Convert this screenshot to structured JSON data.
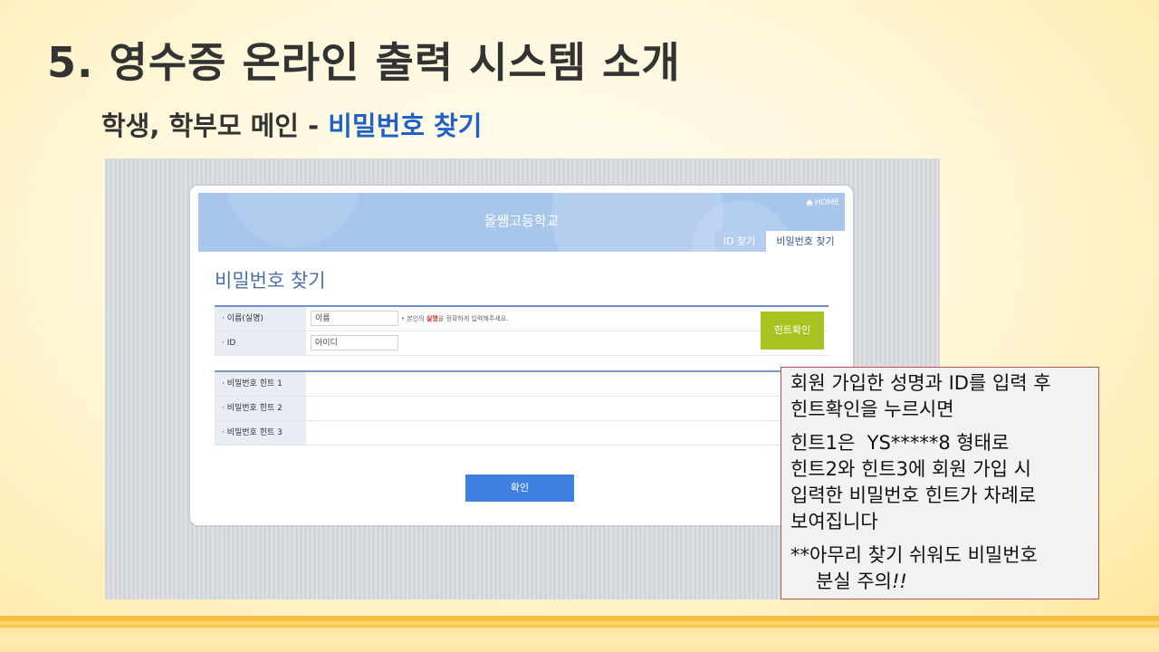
{
  "slide": {
    "title": "5. 영수증 온라인 출력 시스템 소개",
    "subtitle": "학생, 학부모 메인 - ",
    "subtitle_highlight": "비밀번호 찾기"
  },
  "site": {
    "school_name": "올쌤고등학교",
    "home": {
      "icon": "home-icon",
      "label": "HOME"
    },
    "tabs": [
      {
        "label": "ID 찾기",
        "active": false
      },
      {
        "label": "비밀번호 찾기",
        "active": true
      }
    ],
    "page_title": "비밀번호 찾기",
    "form": {
      "name": {
        "label": "· 이름(실명)",
        "placeholder": "이름",
        "note_prefix": "• 본인의 ",
        "note_emphasis": "실명",
        "note_suffix": "을 정확하게 입력해주세요."
      },
      "id": {
        "label": "· ID",
        "placeholder": "아이디"
      },
      "hint_check_button": "힌트확인"
    },
    "hints": [
      {
        "label": "· 비밀번호 힌트 1"
      },
      {
        "label": "· 비밀번호 힌트 2"
      },
      {
        "label": "· 비밀번호 힌트 3"
      }
    ],
    "confirm_button": "확인"
  },
  "callout": {
    "paragraphs": [
      [
        "회원 가입한 성명과 ID를 입력 후",
        "힌트확인을 누르시면"
      ],
      [
        "힌트1은  YS*****8 형태로",
        "힌트2와 힌트3에 회원 가입 시",
        "입력한 비밀번호 힌트가 차례로",
        "보여집니다"
      ]
    ],
    "warning_line": "**아무리 찾기 쉬워도 비밀번호",
    "warning_tail": "분실 주의",
    "warning_tail_emphasis": "!!"
  },
  "colors": {
    "title_highlight": "#1f62c4",
    "banner": "#a8c6ec",
    "hint_button": "#a9c420",
    "confirm_button": "#3f80e0",
    "callout_border": "#c0504d",
    "required_emphasis": "#e02424"
  }
}
